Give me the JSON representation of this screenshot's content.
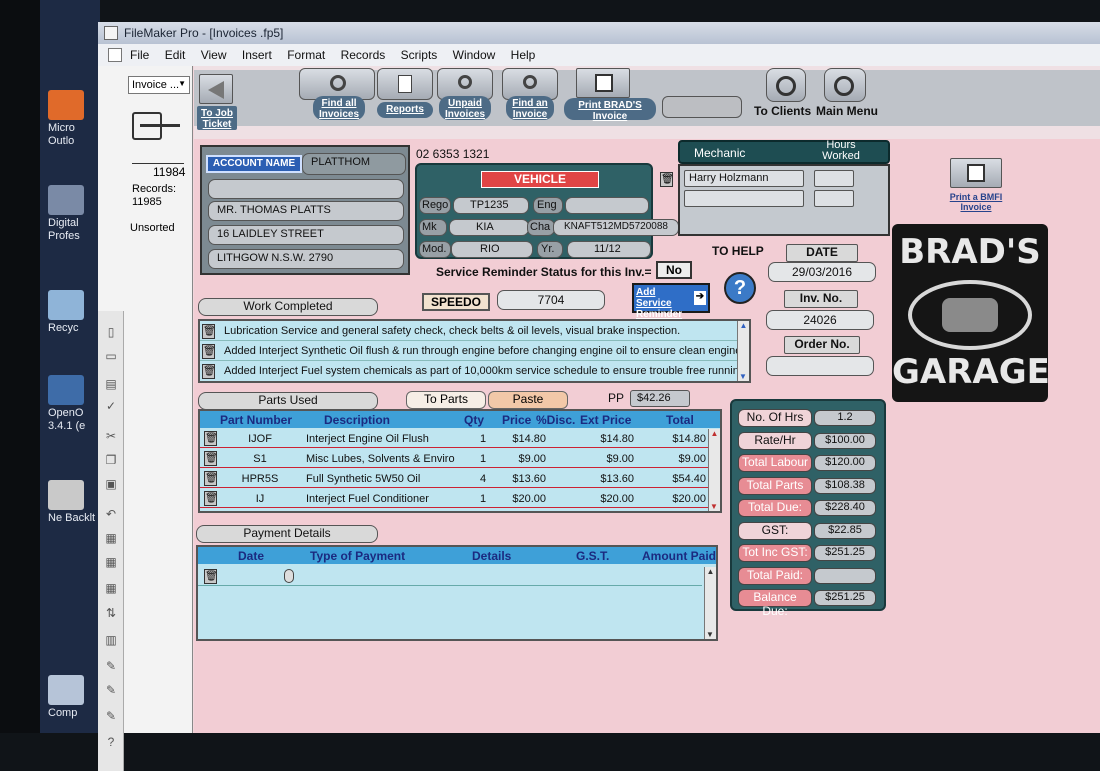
{
  "window": {
    "title": "FileMaker Pro - [Invoices .fp5]"
  },
  "menu": [
    "File",
    "Edit",
    "View",
    "Insert",
    "Format",
    "Records",
    "Scripts",
    "Window",
    "Help"
  ],
  "desktop_icons": [
    "Micro Outlo",
    "Digital Profes",
    "Recyc",
    "OpenO 3.4.1 (e",
    "Ne Backlt",
    "Comp"
  ],
  "status": {
    "layout_select": "Invoice ...",
    "record_number": "11984",
    "records_label": "Records:",
    "records_count": "11985",
    "sort_state": "Unsorted"
  },
  "toolbar": {
    "to_job_ticket": "To Job Ticket",
    "find_all": "Find all Invoices",
    "reports": "Reports",
    "unpaid": "Unpaid Invoices",
    "find_an": "Find an Invoice",
    "print_brads": "Print BRAD'S Invoice",
    "to_clients": "To Clients",
    "main_menu": "Main Menu"
  },
  "account": {
    "label": "ACCOUNT NAME",
    "name": "PLATTHOM",
    "line1": "",
    "line2": "MR. THOMAS  PLATTS",
    "line3": "16 LAIDLEY STREET",
    "line4": "LITHGOW N.S.W. 2790",
    "phone": "02 6353 1321"
  },
  "vehicle": {
    "title": "VEHICLE",
    "rego_label": "Rego",
    "rego": "TP1235",
    "eng_label": "Eng",
    "eng": "",
    "mk_label": "Mk",
    "make": "KIA",
    "cha_label": "Cha",
    "chassis": "KNAFT512MD5720088",
    "mod_label": "Mod.",
    "model": "RIO",
    "yr_label": "Yr.",
    "year": "11/12"
  },
  "mechanic": {
    "label": "Mechanic",
    "hours_label": "Hours Worked",
    "name1": "Harry Holzmann",
    "hours1": "",
    "name2": "",
    "hours2": ""
  },
  "print_bmfi": "Print a BMFI Invoice",
  "logo": {
    "top": "BRAD'S",
    "bottom": "GARAGE"
  },
  "help": {
    "label": "TO HELP"
  },
  "dates": {
    "date_label": "DATE",
    "date": "29/03/2016",
    "inv_label": "Inv. No.",
    "inv": "24026",
    "order_label": "Order No.",
    "order": ""
  },
  "reminder": {
    "label": "Service Reminder Status for this Inv.=",
    "value": "No",
    "add_button": "Add Service Reminder"
  },
  "speedo": {
    "label": "SPEEDO",
    "value": "7704"
  },
  "work": {
    "title": "Work Completed",
    "lines": [
      "Lubrication Service  and general safety check, check belts & oil levels, visual brake inspection.",
      "Added Interject Synthetic Oil flush & run through engine before changing engine oil to ensure clean engine",
      "Added Interject Fuel system chemicals as part of 10,000km service schedule to ensure trouble free running"
    ]
  },
  "parts": {
    "title": "Parts Used",
    "to_parts": "To Parts",
    "paste": "Paste",
    "pp_label": "PP",
    "pp_value": "$42.26",
    "columns": [
      "Part Number",
      "Description",
      "Qty",
      "Price",
      "%Disc.",
      "Ext Price",
      "Total"
    ],
    "rows": [
      {
        "part": "IJOF",
        "desc": "Interject Engine Oil Flush",
        "qty": "1",
        "price": "$14.80",
        "disc": "",
        "ext": "$14.80",
        "total": "$14.80"
      },
      {
        "part": "S1",
        "desc": "Misc Lubes, Solvents & Enviro",
        "qty": "1",
        "price": "$9.00",
        "disc": "",
        "ext": "$9.00",
        "total": "$9.00"
      },
      {
        "part": "HPR5S",
        "desc": "Full Synthetic 5W50 Oil",
        "qty": "4",
        "price": "$13.60",
        "disc": "",
        "ext": "$13.60",
        "total": "$54.40"
      },
      {
        "part": "IJ",
        "desc": "Interject Fuel Conditioner",
        "qty": "1",
        "price": "$20.00",
        "disc": "",
        "ext": "$20.00",
        "total": "$20.00"
      }
    ]
  },
  "payment": {
    "title": "Payment Details",
    "columns": [
      "Date",
      "Type of Payment",
      "Details",
      "G.S.T.",
      "Amount Paid"
    ]
  },
  "totals": [
    {
      "label": "No. Of Hrs",
      "value": "1.2"
    },
    {
      "label": "Rate/Hr",
      "value": "$100.00"
    },
    {
      "label": "Total Labour",
      "value": "$120.00"
    },
    {
      "label": "Total Parts",
      "value": "$108.38"
    },
    {
      "label": "Total Due:",
      "value": "$228.40"
    },
    {
      "label": "GST:",
      "value": "$22.85"
    },
    {
      "label": "Tot Inc GST:",
      "value": "$251.25"
    },
    {
      "label": "Total Paid:",
      "value": ""
    },
    {
      "label": "Balance Due:",
      "value": "$251.25"
    }
  ]
}
